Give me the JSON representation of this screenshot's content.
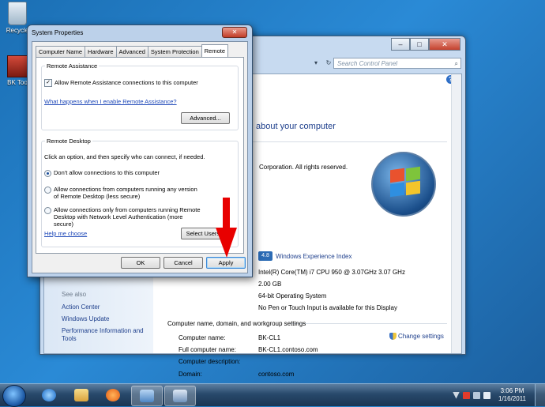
{
  "desktop": {
    "icons": [
      {
        "label": "Recycle"
      },
      {
        "label": "BK Too"
      }
    ]
  },
  "control_panel": {
    "search_placeholder": "Search Control Panel",
    "heading": "about your computer",
    "copyright": "Corporation.  All rights reserved.",
    "wei_score": "4.8",
    "wei_link": "Windows Experience Index",
    "processor": "Intel(R) Core(TM) i7 CPU        950  @ 3.07GHz   3.07 GHz",
    "memory": "2.00 GB",
    "system_type": "64-bit Operating System",
    "pen_touch": "No Pen or Touch Input is available for this Display",
    "section_title": "Computer name, domain, and workgroup settings",
    "change_settings": "Change settings",
    "rows": [
      {
        "label": "Computer name:",
        "value": "BK-CL1"
      },
      {
        "label": "Full computer name:",
        "value": "BK-CL1.contoso.com"
      },
      {
        "label": "Computer description:",
        "value": ""
      },
      {
        "label": "Domain:",
        "value": "contoso.com"
      }
    ],
    "left_pane": {
      "see_also": "See also",
      "links": [
        "Action Center",
        "Windows Update",
        "Performance Information and Tools"
      ]
    }
  },
  "dialog": {
    "title": "System Properties",
    "tabs": [
      "Computer Name",
      "Hardware",
      "Advanced",
      "System Protection",
      "Remote"
    ],
    "active_tab": "Remote",
    "remote_assistance": {
      "group_label": "Remote Assistance",
      "checkbox_label": "Allow Remote Assistance connections to this computer",
      "checked": true,
      "link": "What happens when I enable Remote Assistance?",
      "advanced_button": "Advanced..."
    },
    "remote_desktop": {
      "group_label": "Remote Desktop",
      "instructions": "Click an option, and then specify who can connect, if needed.",
      "options": [
        "Don't allow connections to this computer",
        "Allow connections from computers running any version of Remote Desktop (less secure)",
        "Allow connections only from computers running Remote Desktop with Network Level Authentication (more secure)"
      ],
      "selected_index": 0,
      "help_link": "Help me choose",
      "select_users_button": "Select Users..."
    },
    "buttons": {
      "ok": "OK",
      "cancel": "Cancel",
      "apply": "Apply"
    }
  },
  "taskbar": {
    "time": "3:06 PM",
    "date": "1/16/2011"
  },
  "colors": {
    "desktop": "#2a8ad6",
    "link": "#1e3f8c",
    "arrow": "#e80000"
  }
}
